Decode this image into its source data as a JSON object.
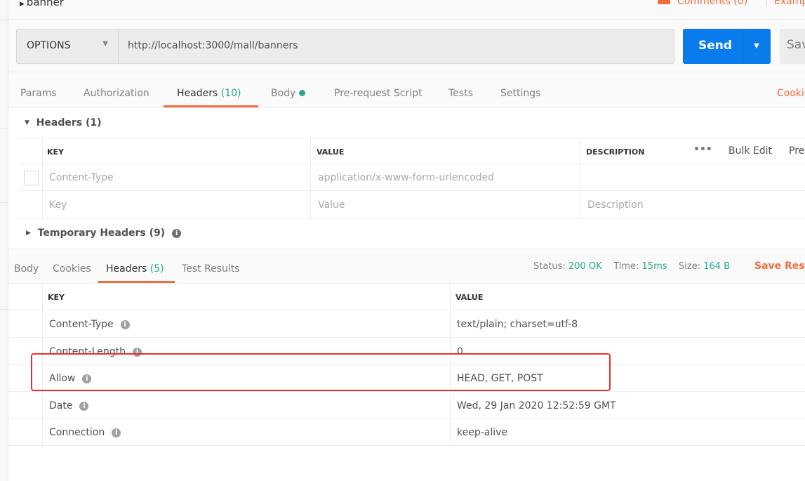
{
  "request": {
    "name": "banner",
    "comments": "Comments (0)",
    "examples": "Examples",
    "method": "OPTIONS",
    "url": "http://localhost:3000/mall/banners",
    "send": "Send",
    "save": "Save"
  },
  "tabs": [
    {
      "label": "Params"
    },
    {
      "label": "Authorization"
    },
    {
      "label": "Headers",
      "count": "(10)"
    },
    {
      "label": "Body"
    },
    {
      "label": "Pre-request Script"
    },
    {
      "label": "Tests"
    },
    {
      "label": "Settings"
    }
  ],
  "cookies": "Cookies",
  "req_headers": {
    "title": "Headers (1)",
    "columns": [
      "KEY",
      "VALUE",
      "DESCRIPTION"
    ],
    "more": "•••",
    "bulk_edit": "Bulk Edit",
    "presets": "Presets",
    "rows": [
      {
        "key": "Content-Type",
        "value": "application/x-www-form-urlencoded",
        "description": ""
      }
    ],
    "placeholder": {
      "key": "Key",
      "value": "Value",
      "description": "Description"
    }
  },
  "temp_headers": "Temporary Headers (9)",
  "response": {
    "tabs": [
      {
        "label": "Body"
      },
      {
        "label": "Cookies"
      },
      {
        "label": "Headers",
        "count": "(5)"
      },
      {
        "label": "Test Results"
      }
    ],
    "status_label": "Status:",
    "status": "200 OK",
    "time_label": "Time:",
    "time": "15ms",
    "size_label": "Size:",
    "size": "164 B",
    "save": "Save Response",
    "columns": [
      "KEY",
      "VALUE"
    ],
    "rows": [
      {
        "key": "Content-Type",
        "value": "text/plain; charset=utf-8"
      },
      {
        "key": "Content-Length",
        "value": "0"
      },
      {
        "key": "Allow",
        "value": "HEAD, GET, POST"
      },
      {
        "key": "Date",
        "value": "Wed, 29 Jan 2020 12:52:59 GMT"
      },
      {
        "key": "Connection",
        "value": "keep-alive"
      }
    ]
  },
  "colors": {
    "accent": "#f26b3a",
    "send": "#097bed",
    "success": "#26a98b",
    "highlight_box": "#e8302c"
  }
}
